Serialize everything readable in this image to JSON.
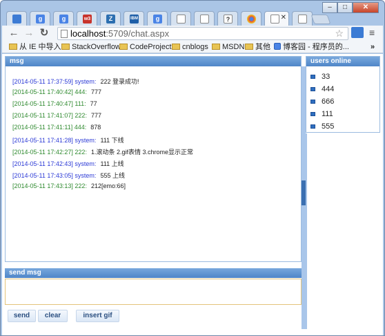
{
  "browser": {
    "tabs": [
      {
        "favicon": "browser-icon",
        "color": "#3c7bd4",
        "label": ""
      },
      {
        "favicon": "google-icon",
        "color": "#4a84e6",
        "label": "g"
      },
      {
        "favicon": "google-icon",
        "color": "#4a84e6",
        "label": "g"
      },
      {
        "favicon": "w3-icon",
        "color": "#c8342c",
        "label": "w3"
      },
      {
        "favicon": "z-icon",
        "color": "#2d6fb0",
        "label": "Z"
      },
      {
        "favicon": "ibm-icon",
        "color": "#1f5fa8",
        "label": "IBM"
      },
      {
        "favicon": "google-icon",
        "color": "#4a84e6",
        "label": "g"
      },
      {
        "favicon": "page-icon",
        "color": "#ffffff",
        "label": ""
      },
      {
        "favicon": "page-icon",
        "color": "#ffffff",
        "label": ""
      },
      {
        "favicon": "question-icon",
        "color": "#ffffff",
        "label": "?"
      },
      {
        "favicon": "chrome-icon",
        "color": "#e04a35",
        "label": ""
      },
      {
        "favicon": "page-icon",
        "color": "#ffffff",
        "label": ""
      },
      {
        "favicon": "page-icon",
        "color": "#ffffff",
        "label": "",
        "active": true
      },
      {
        "favicon": "page-icon",
        "color": "#ffffff",
        "label": ""
      }
    ],
    "url_host": "localhost",
    "url_path": ":5709/chat.aspx",
    "bookmarks": [
      {
        "label": "从 IE 中导入",
        "icon": "folder-icon"
      },
      {
        "label": "StackOverflow",
        "icon": "folder-icon"
      },
      {
        "label": "CodeProject",
        "icon": "folder-icon"
      },
      {
        "label": "cnblogs",
        "icon": "folder-icon"
      },
      {
        "label": "MSDN",
        "icon": "folder-icon"
      },
      {
        "label": "其他",
        "icon": "folder-icon"
      },
      {
        "label": "博客园 - 程序员的...",
        "icon": "google-icon"
      }
    ],
    "bookmarks_more": "»"
  },
  "chat": {
    "msg_title": "msg",
    "users_title": "users online",
    "send_title": "send msg",
    "messages": [
      {
        "time": "[2014-05-11 17:37:59]",
        "sender": "system:",
        "text": "222 登录成功!",
        "type": "system"
      },
      {
        "time": "[2014-05-11 17:40:42]",
        "sender": "444:",
        "text": "777",
        "type": "user"
      },
      {
        "time": "[2014-05-11 17:40:47]",
        "sender": "111:",
        "text": "77",
        "type": "user"
      },
      {
        "time": "[2014-05-11 17:41:07]",
        "sender": "222:",
        "text": "777",
        "type": "user"
      },
      {
        "time": "[2014-05-11 17:41:11]",
        "sender": "444:",
        "text": "878",
        "type": "user"
      },
      {
        "time": "[2014-05-11 17:41:28]",
        "sender": "system:",
        "text": "111 下线",
        "type": "system"
      },
      {
        "time": "[2014-05-11 17:42:27]",
        "sender": "222:",
        "text": "1.滚动条 2.gif表情 3.chrome显示正常",
        "type": "user"
      },
      {
        "time": "[2014-05-11 17:42:43]",
        "sender": "system:",
        "text": "111 上线",
        "type": "system"
      },
      {
        "time": "[2014-05-11 17:43:05]",
        "sender": "system:",
        "text": "555 上线",
        "type": "system"
      },
      {
        "time": "[2014-05-11 17:43:13]",
        "sender": "222:",
        "text": "212[emo:66]",
        "type": "user"
      }
    ],
    "users": [
      "33",
      "444",
      "666",
      "111",
      "555"
    ],
    "input_value": "",
    "buttons": {
      "send": "send",
      "clear": "clear",
      "insert_gif": "insert gif"
    }
  }
}
